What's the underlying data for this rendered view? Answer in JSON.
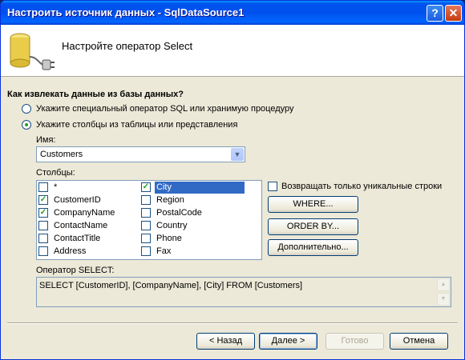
{
  "window": {
    "title": "Настроить источник данных - SqlDataSource1",
    "help": "?",
    "close": "✕"
  },
  "header": {
    "title": "Настройте оператор Select",
    "icon": "database-connector-icon"
  },
  "question": "Как извлекать данные из базы данных?",
  "options": {
    "custom_sql": "Укажите специальный оператор SQL или хранимую процедуру",
    "columns_from_table": "Укажите столбцы из таблицы или представления",
    "selected": "columns_from_table"
  },
  "name_label": "Имя:",
  "table_name": "Customers",
  "columns_label": "Столбцы:",
  "columns": [
    {
      "label": "*",
      "checked": false
    },
    {
      "label": "CustomerID",
      "checked": true
    },
    {
      "label": "CompanyName",
      "checked": true
    },
    {
      "label": "ContactName",
      "checked": false
    },
    {
      "label": "ContactTitle",
      "checked": false
    },
    {
      "label": "Address",
      "checked": false
    },
    {
      "label": "City",
      "checked": true,
      "selected": true
    },
    {
      "label": "Region",
      "checked": false
    },
    {
      "label": "PostalCode",
      "checked": false
    },
    {
      "label": "Country",
      "checked": false
    },
    {
      "label": "Phone",
      "checked": false
    },
    {
      "label": "Fax",
      "checked": false
    }
  ],
  "unique_rows": {
    "label": "Возвращать только уникальные строки",
    "checked": false
  },
  "buttons": {
    "where": "WHERE...",
    "order_by": "ORDER BY...",
    "advanced": "Дополнительно...",
    "back": "< Назад",
    "next": "Далее >",
    "finish": "Готово",
    "cancel": "Отмена"
  },
  "select_label": "Оператор SELECT:",
  "select_statement": "SELECT [CustomerID], [CompanyName], [City] FROM [Customers]"
}
